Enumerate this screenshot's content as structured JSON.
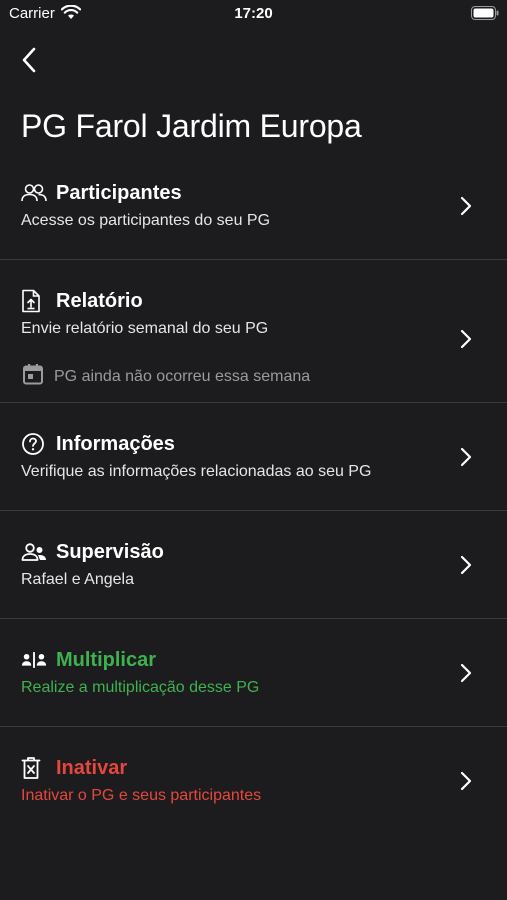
{
  "status_bar": {
    "carrier": "Carrier",
    "time": "17:20"
  },
  "page": {
    "title": "PG Farol Jardim Europa"
  },
  "colors": {
    "background": "#1c1c1e",
    "divider": "#3a3a3c",
    "accent_green": "#3fb14f",
    "danger_red": "#e5473d",
    "muted": "#9a9a9f"
  },
  "menu": [
    {
      "id": "participantes",
      "icon": "people-outline-icon",
      "title": "Participantes",
      "subtitle": "Acesse os participantes do seu PG"
    },
    {
      "id": "relatorio",
      "icon": "upload-document-icon",
      "title": "Relatório",
      "subtitle": "Envie relatório semanal do seu PG",
      "note_icon": "calendar-icon",
      "note": "PG ainda não ocorreu essa semana"
    },
    {
      "id": "informacoes",
      "icon": "help-circle-icon",
      "title": "Informações",
      "subtitle": "Verifique as informações relacionadas ao seu PG"
    },
    {
      "id": "supervisao",
      "icon": "supervisor-account-icon",
      "title": "Supervisão",
      "subtitle": "Rafael e Angela"
    },
    {
      "id": "multiplicar",
      "icon": "split-people-icon",
      "title": "Multiplicar",
      "subtitle": "Realize a multiplicação desse PG",
      "color": "green"
    },
    {
      "id": "inativar",
      "icon": "delete-box-icon",
      "title": "Inativar",
      "subtitle": "Inativar o PG e seus participantes",
      "color": "red"
    }
  ]
}
